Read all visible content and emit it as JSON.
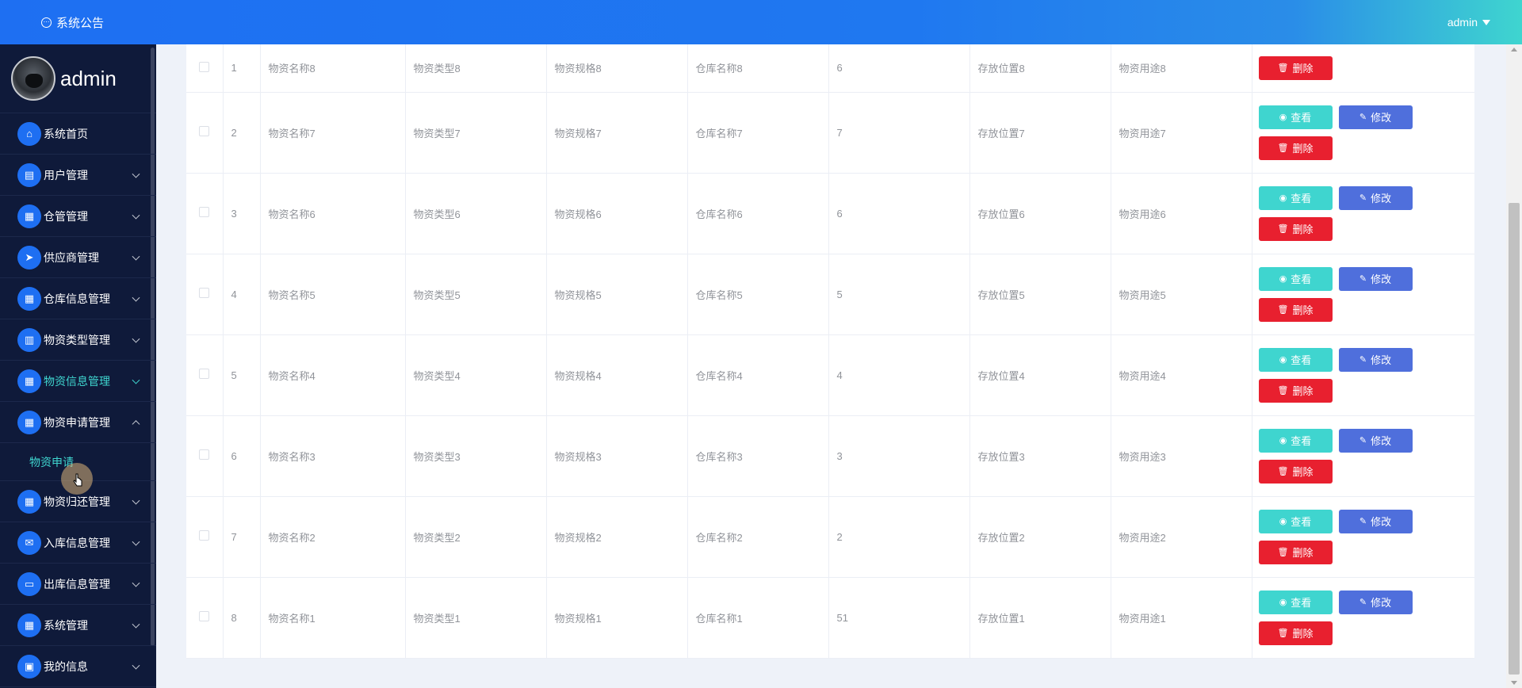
{
  "header": {
    "title": "系统公告",
    "user": "admin"
  },
  "sidebar": {
    "username": "admin",
    "items": [
      {
        "label": "系统首页",
        "icon": "home-icon",
        "glyph": "⌂",
        "arrow": ""
      },
      {
        "label": "用户管理",
        "icon": "chat-icon",
        "glyph": "▤",
        "arrow": "down"
      },
      {
        "label": "仓管管理",
        "icon": "grid-icon",
        "glyph": "▦",
        "arrow": "down"
      },
      {
        "label": "供应商管理",
        "icon": "send-icon",
        "glyph": "➤",
        "arrow": "down"
      },
      {
        "label": "仓库信息管理",
        "icon": "grid-icon",
        "glyph": "▦",
        "arrow": "down"
      },
      {
        "label": "物资类型管理",
        "icon": "book-icon",
        "glyph": "▥",
        "arrow": "down"
      },
      {
        "label": "物资信息管理",
        "icon": "grid-icon",
        "glyph": "▦",
        "arrow": "down",
        "active": true
      },
      {
        "label": "物资申请管理",
        "icon": "grid-icon",
        "glyph": "▦",
        "arrow": "up",
        "submenu": "物资申请"
      },
      {
        "label": "物资归还管理",
        "icon": "grid-icon",
        "glyph": "▦",
        "arrow": "down"
      },
      {
        "label": "入库信息管理",
        "icon": "ticket-icon",
        "glyph": "✉",
        "arrow": "down"
      },
      {
        "label": "出库信息管理",
        "icon": "monitor-icon",
        "glyph": "▭",
        "arrow": "down"
      },
      {
        "label": "系统管理",
        "icon": "apps-icon",
        "glyph": "▦",
        "arrow": "down"
      },
      {
        "label": "我的信息",
        "icon": "card-icon",
        "glyph": "▣",
        "arrow": "down"
      }
    ]
  },
  "buttons": {
    "view": "查看",
    "edit": "修改",
    "delete": "删除"
  },
  "table": {
    "rows": [
      {
        "index": "1",
        "name": "物资名称8",
        "type": "物资类型8",
        "spec": "物资规格8",
        "warehouse": "仓库名称8",
        "qty": "6",
        "location": "存放位置8",
        "purpose": "物资用途8",
        "partial": true
      },
      {
        "index": "2",
        "name": "物资名称7",
        "type": "物资类型7",
        "spec": "物资规格7",
        "warehouse": "仓库名称7",
        "qty": "7",
        "location": "存放位置7",
        "purpose": "物资用途7"
      },
      {
        "index": "3",
        "name": "物资名称6",
        "type": "物资类型6",
        "spec": "物资规格6",
        "warehouse": "仓库名称6",
        "qty": "6",
        "location": "存放位置6",
        "purpose": "物资用途6"
      },
      {
        "index": "4",
        "name": "物资名称5",
        "type": "物资类型5",
        "spec": "物资规格5",
        "warehouse": "仓库名称5",
        "qty": "5",
        "location": "存放位置5",
        "purpose": "物资用途5"
      },
      {
        "index": "5",
        "name": "物资名称4",
        "type": "物资类型4",
        "spec": "物资规格4",
        "warehouse": "仓库名称4",
        "qty": "4",
        "location": "存放位置4",
        "purpose": "物资用途4"
      },
      {
        "index": "6",
        "name": "物资名称3",
        "type": "物资类型3",
        "spec": "物资规格3",
        "warehouse": "仓库名称3",
        "qty": "3",
        "location": "存放位置3",
        "purpose": "物资用途3"
      },
      {
        "index": "7",
        "name": "物资名称2",
        "type": "物资类型2",
        "spec": "物资规格2",
        "warehouse": "仓库名称2",
        "qty": "2",
        "location": "存放位置2",
        "purpose": "物资用途2"
      },
      {
        "index": "8",
        "name": "物资名称1",
        "type": "物资类型1",
        "spec": "物资规格1",
        "warehouse": "仓库名称1",
        "qty": "51",
        "location": "存放位置1",
        "purpose": "物资用途1"
      }
    ]
  }
}
